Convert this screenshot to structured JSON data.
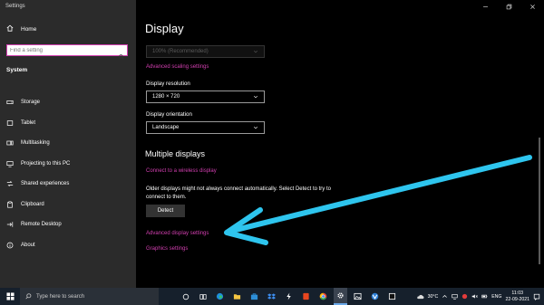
{
  "window": {
    "title": "Settings"
  },
  "sidebar": {
    "home_label": "Home",
    "search_placeholder": "Find a setting",
    "section_label": "System",
    "items": [
      {
        "label": "Storage",
        "icon": "storage-icon"
      },
      {
        "label": "Tablet",
        "icon": "tablet-icon"
      },
      {
        "label": "Multitasking",
        "icon": "multitasking-icon"
      },
      {
        "label": "Projecting to this PC",
        "icon": "projecting-icon"
      },
      {
        "label": "Shared experiences",
        "icon": "shared-experiences-icon"
      },
      {
        "label": "Clipboard",
        "icon": "clipboard-icon"
      },
      {
        "label": "Remote Desktop",
        "icon": "remote-desktop-icon"
      },
      {
        "label": "About",
        "icon": "info-icon"
      }
    ]
  },
  "main": {
    "page_title": "Display",
    "scale_value": "100% (Recommended)",
    "advanced_scaling_link": "Advanced scaling settings",
    "resolution_label": "Display resolution",
    "resolution_value": "1280 × 720",
    "orientation_label": "Display orientation",
    "orientation_value": "Landscape",
    "multiple_displays_heading": "Multiple displays",
    "wireless_link": "Connect to a wireless display",
    "older_displays_text": "Older displays might not always connect automatically. Select Detect to try to connect to them.",
    "detect_label": "Detect",
    "advanced_display_link": "Advanced display settings",
    "graphics_link": "Graphics settings"
  },
  "annotation": {
    "arrow_color": "#2ec5ee"
  },
  "taskbar": {
    "search_placeholder": "Type here to search",
    "weather": "30°C",
    "language": "ENG",
    "time": "11:03",
    "date": "22-09-2021"
  },
  "colors": {
    "accent_link": "#d23fb0",
    "sidebar_bg": "#2b2b2b",
    "taskbar_bg": "#16202c"
  }
}
